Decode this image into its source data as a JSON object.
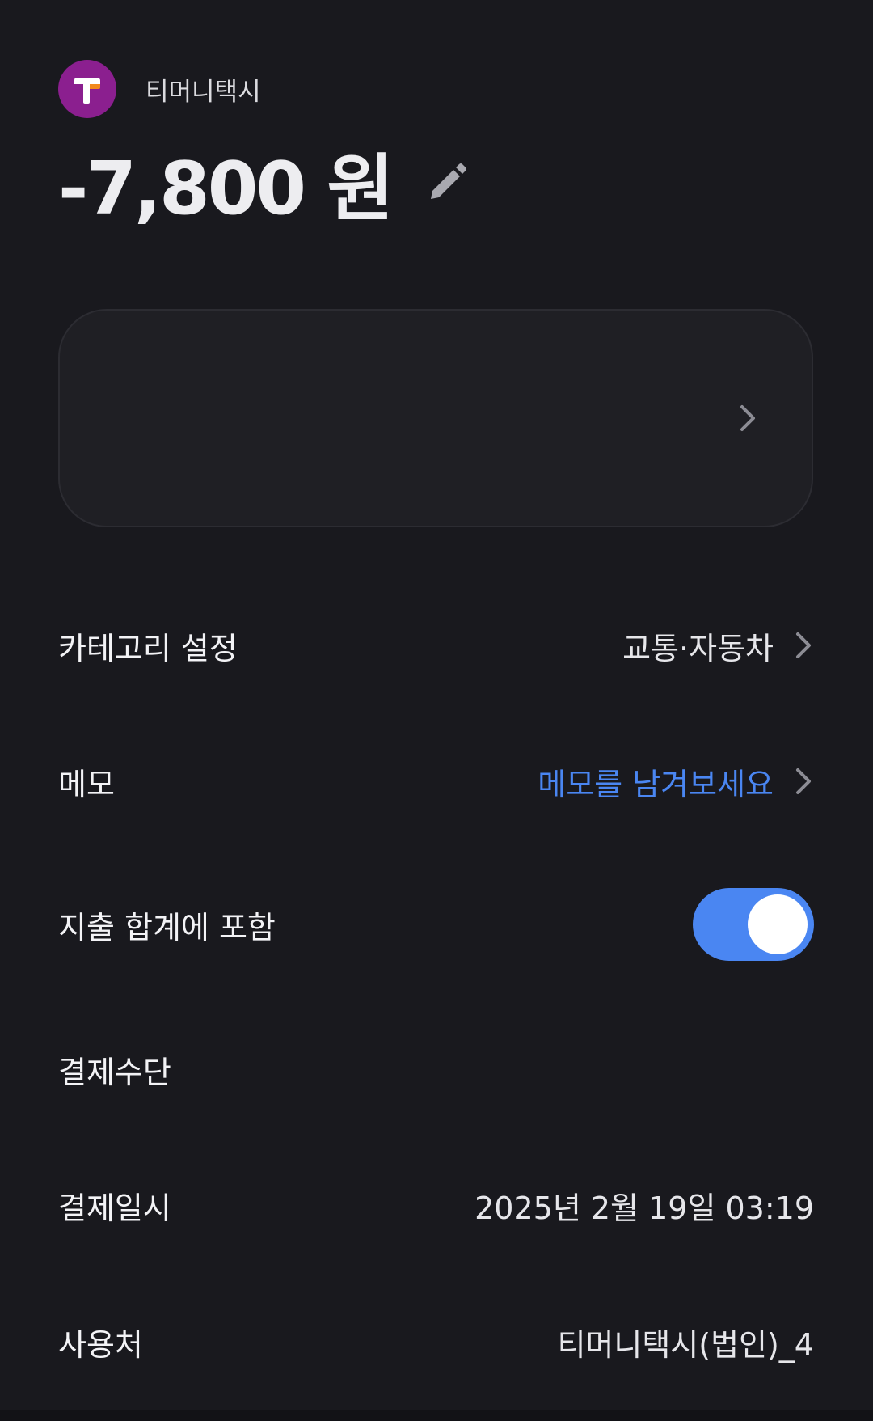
{
  "merchant": {
    "name": "티머니택시",
    "logo_color": "#8b1f8f",
    "logo_letter_color": "#ffffff",
    "logo_accent_color": "#f28a1c"
  },
  "transaction": {
    "amount": "-7,800 원"
  },
  "rows": {
    "category": {
      "label": "카테고리 설정",
      "value": "교통·자동차"
    },
    "memo": {
      "label": "메모",
      "placeholder": "메모를 남겨보세요"
    },
    "include_in_total": {
      "label": "지출 합계에 포함",
      "enabled": true
    },
    "payment_method": {
      "label": "결제수단",
      "value": ""
    },
    "payment_date": {
      "label": "결제일시",
      "value": "2025년 2월 19일 03:19"
    },
    "merchant_detail": {
      "label": "사용처",
      "value": "티머니택시(법인)_4"
    }
  },
  "colors": {
    "background": "#19191e",
    "card": "#1f1f24",
    "accent": "#4a86f2",
    "chevron": "#8c8c94"
  },
  "icons": {
    "edit": "pencil-icon",
    "chevron": "chevron-right-icon",
    "logo": "tmoney-logo"
  }
}
